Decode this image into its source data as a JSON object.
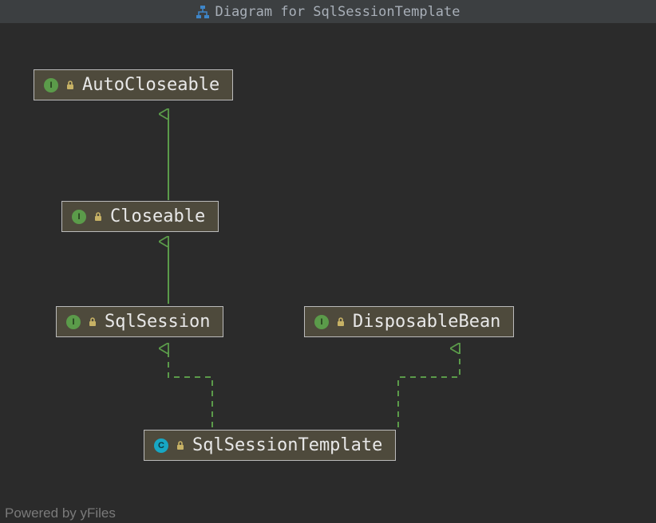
{
  "header": {
    "title": "Diagram for SqlSessionTemplate"
  },
  "nodes": {
    "autocloseable": {
      "label": "AutoCloseable",
      "kind": "I",
      "kind_letter": "I"
    },
    "closeable": {
      "label": "Closeable",
      "kind": "I",
      "kind_letter": "I"
    },
    "sqlsession": {
      "label": "SqlSession",
      "kind": "I",
      "kind_letter": "I"
    },
    "disposablebean": {
      "label": "DisposableBean",
      "kind": "I",
      "kind_letter": "I"
    },
    "sqlsessiontemplate": {
      "label": "SqlSessionTemplate",
      "kind": "C",
      "kind_letter": "C"
    }
  },
  "edges": [
    {
      "from": "closeable",
      "to": "autocloseable",
      "style": "solid"
    },
    {
      "from": "sqlsession",
      "to": "closeable",
      "style": "solid"
    },
    {
      "from": "sqlsessiontemplate",
      "to": "sqlsession",
      "style": "dashed"
    },
    {
      "from": "sqlsessiontemplate",
      "to": "disposablebean",
      "style": "dashed"
    }
  ],
  "footer": "Powered by yFiles",
  "colors": {
    "edge": "#5b9b4a"
  }
}
